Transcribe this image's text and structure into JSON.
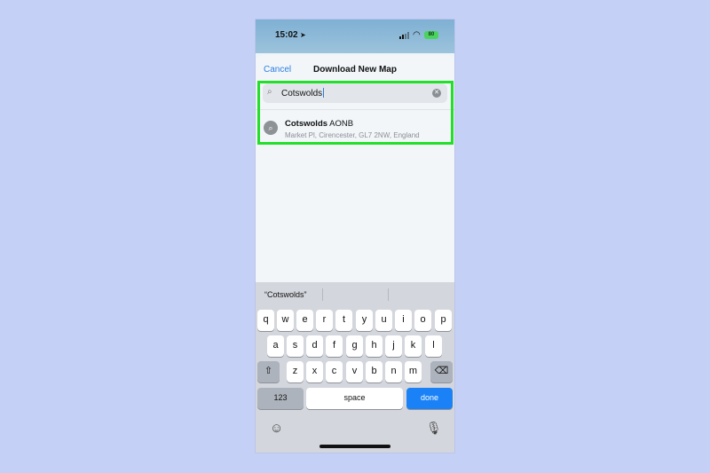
{
  "status": {
    "time": "15:02",
    "battery": "80"
  },
  "nav": {
    "cancel": "Cancel",
    "title": "Download New Map"
  },
  "search": {
    "query": "Cotswolds"
  },
  "result": {
    "title_bold": "Cotswolds",
    "title_rest": " AONB",
    "subtitle": "Market Pl, Cirencester, GL7 2NW, England"
  },
  "keyboard": {
    "suggestion": "“Cotswolds”",
    "row1": [
      "q",
      "w",
      "e",
      "r",
      "t",
      "y",
      "u",
      "i",
      "o",
      "p"
    ],
    "row2": [
      "a",
      "s",
      "d",
      "f",
      "g",
      "h",
      "j",
      "k",
      "l"
    ],
    "row3": [
      "z",
      "x",
      "c",
      "v",
      "b",
      "n",
      "m"
    ],
    "numbers_label": "123",
    "space_label": "space",
    "done_label": "done"
  },
  "colors": {
    "highlight": "#22e02a",
    "accent": "#2a7de1",
    "done": "#1a82f6"
  }
}
